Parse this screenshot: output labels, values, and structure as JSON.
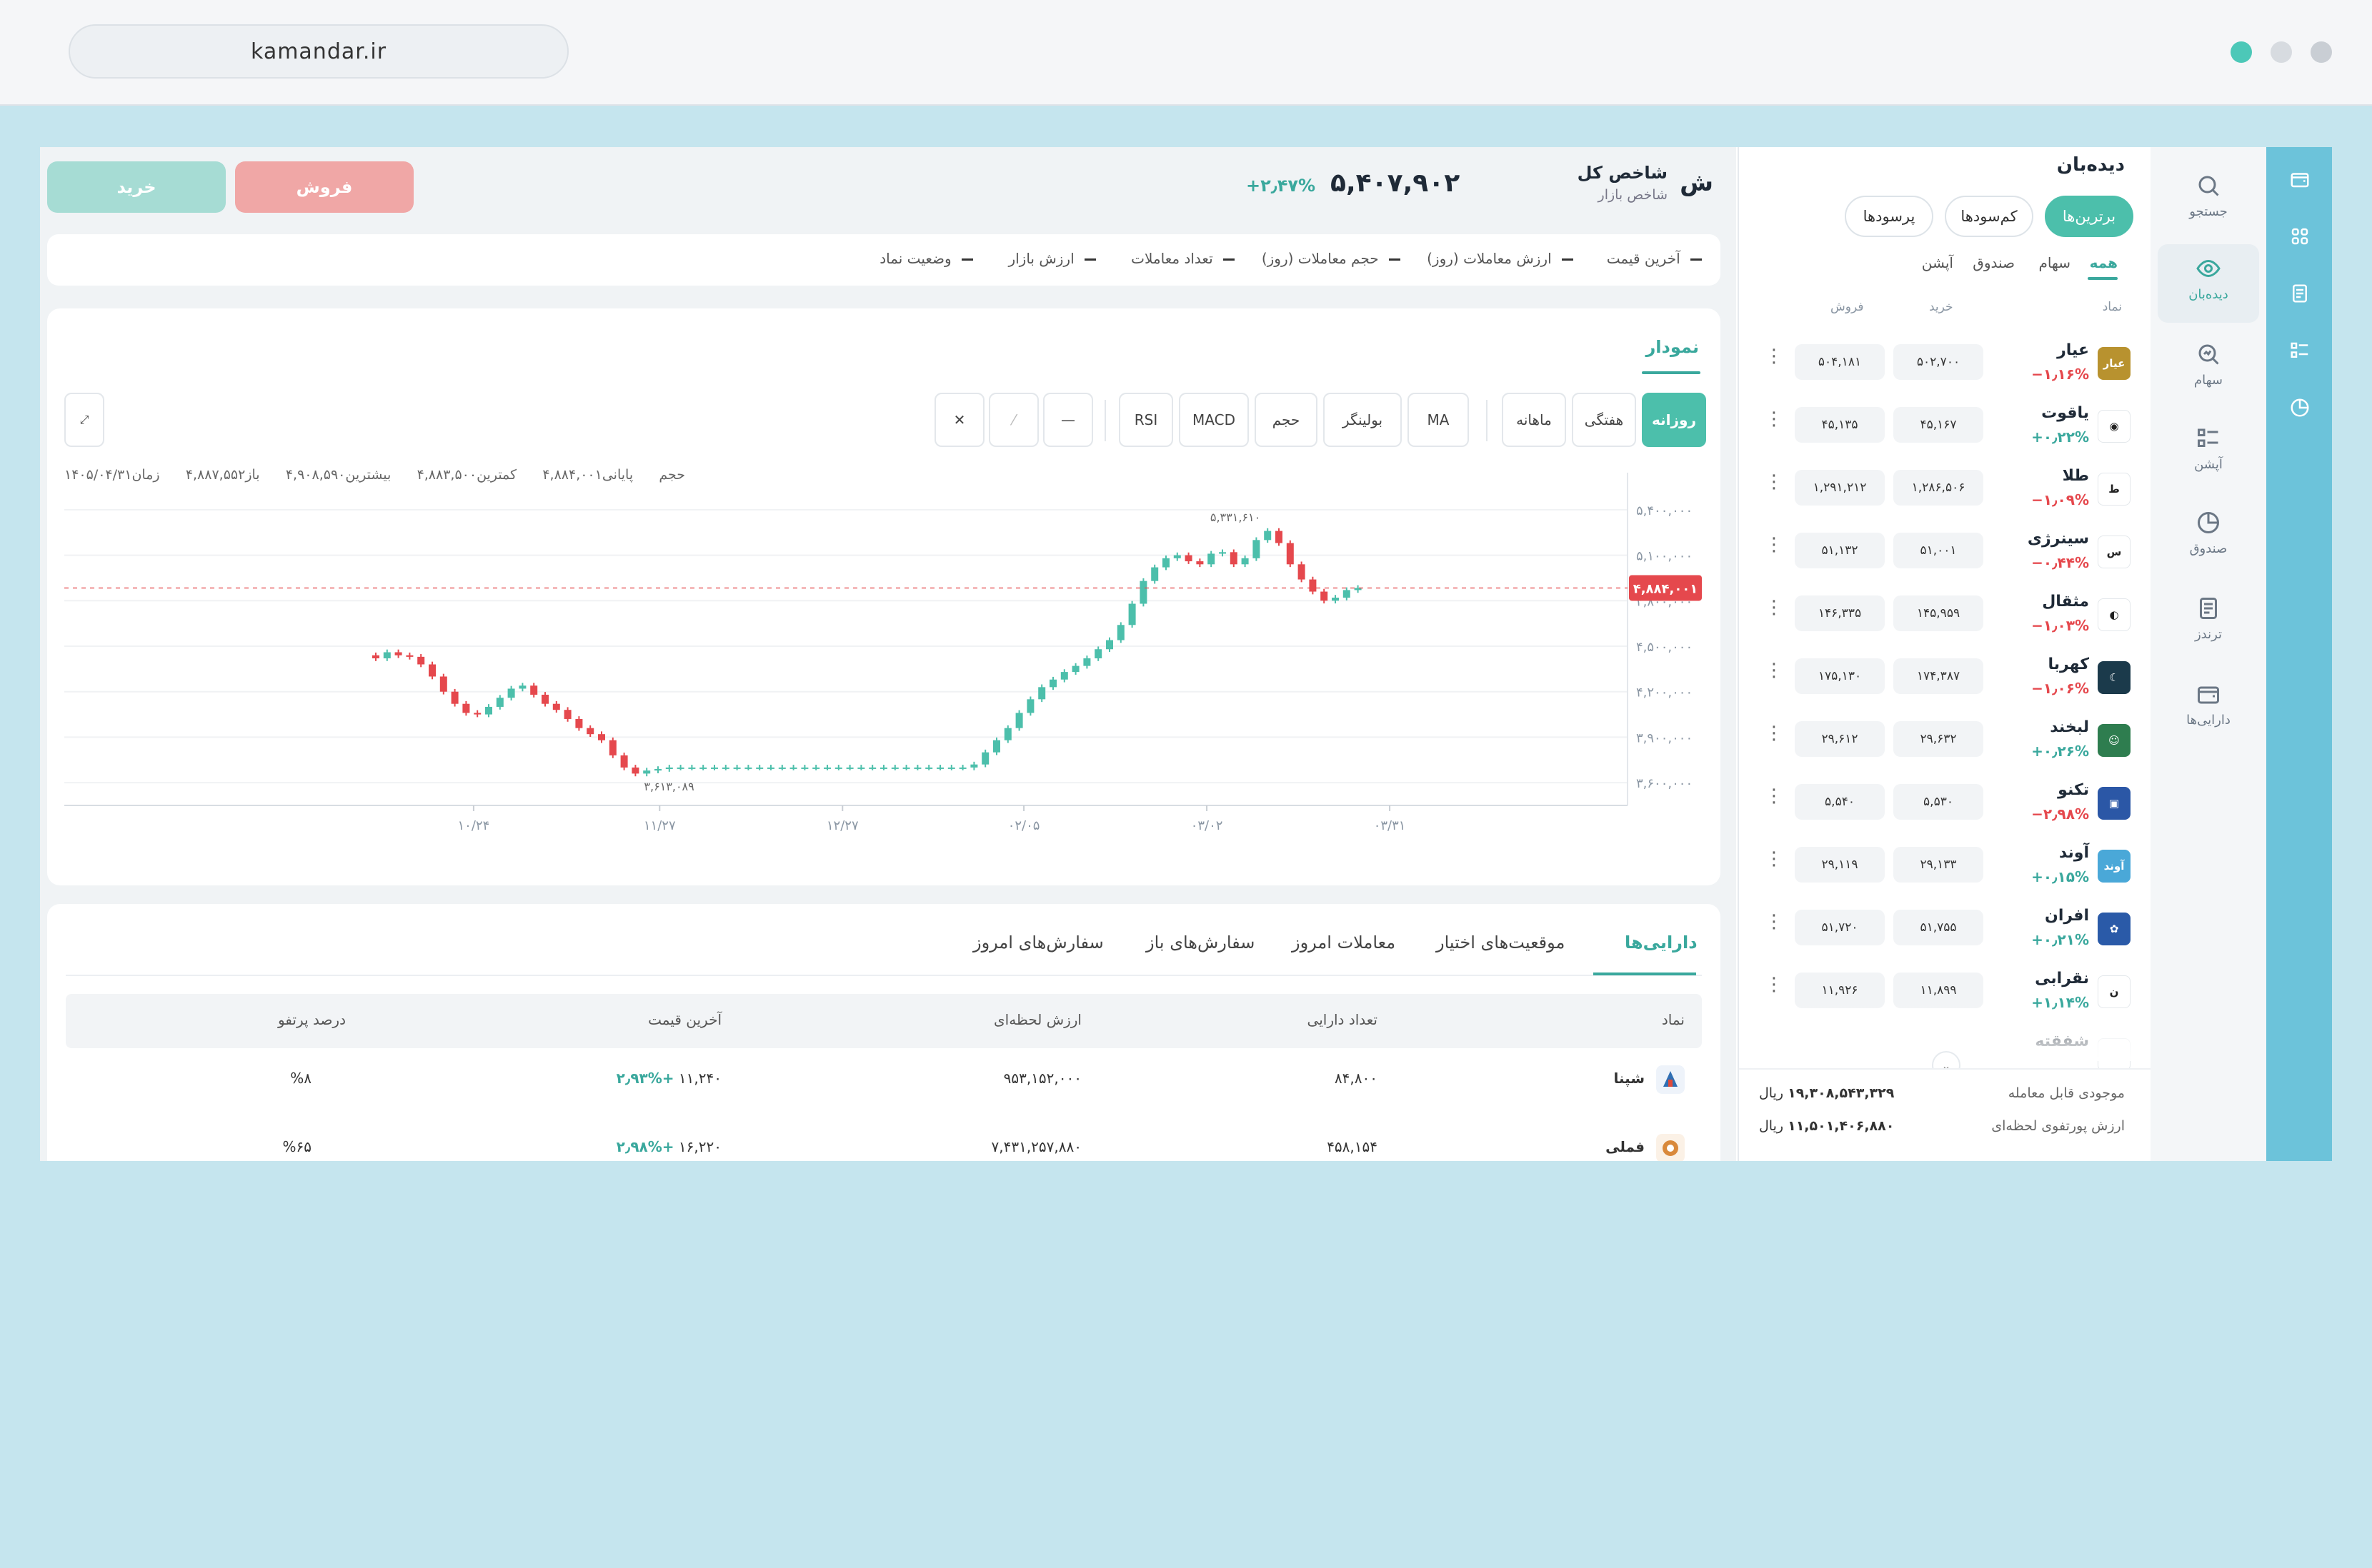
{
  "browser": {
    "url": "kamandar.ir"
  },
  "colors": {
    "accent": "#4cbfab",
    "positive": "#3aa89d",
    "negative": "#e5484d",
    "rail": "#6cc3da",
    "sell": "#f0a7a6",
    "buy": "#a6dcd4"
  },
  "sidenav": {
    "items": [
      {
        "label": "جستجو",
        "icon": "search-icon"
      },
      {
        "label": "دیده‌بان",
        "icon": "eye-icon",
        "active": true
      },
      {
        "label": "سهام",
        "icon": "stock-search-icon"
      },
      {
        "label": "آپشن",
        "icon": "checklist-icon"
      },
      {
        "label": "صندوق",
        "icon": "pie-icon"
      },
      {
        "label": "ترندز",
        "icon": "document-icon"
      },
      {
        "label": "دارایی‌ها",
        "icon": "wallet-icon"
      }
    ]
  },
  "watchlist": {
    "title": "دیده‌بان",
    "pills": [
      "برترین‌ها",
      "کم‌سودها",
      "پرسودها"
    ],
    "subtabs": [
      "همه",
      "سهام",
      "صندوق",
      "آپشن"
    ],
    "columns": {
      "symbol": "نماد",
      "buy": "خرید",
      "sell": "فروش"
    },
    "items": [
      {
        "name": "عیار",
        "change": "−۱٫۱۶%",
        "dir": "neg",
        "buy": "۵۰۲,۷۰۰",
        "sell": "۵۰۴,۱۸۱",
        "logo_text": "عیار",
        "logo_color": "#b8922f"
      },
      {
        "name": "یاقوت",
        "change": "+۰٫۲۲%",
        "dir": "pos",
        "buy": "۴۵,۱۶۷",
        "sell": "۴۵,۱۳۵",
        "logo_text": "◉",
        "logo_color": "#ffffff"
      },
      {
        "name": "طلا",
        "change": "−۱٫۰۹%",
        "dir": "neg",
        "buy": "۱,۲۸۶,۵۰۶",
        "sell": "۱,۲۹۱,۲۱۲",
        "logo_text": "ط",
        "logo_color": "#ffffff"
      },
      {
        "name": "سینرژی",
        "change": "−۰٫۴۴%",
        "dir": "neg",
        "buy": "۵۱,۰۰۱",
        "sell": "۵۱,۱۳۲",
        "logo_text": "س",
        "logo_color": "#ffffff"
      },
      {
        "name": "مثقال",
        "change": "−۱٫۰۳%",
        "dir": "neg",
        "buy": "۱۴۵,۹۵۹",
        "sell": "۱۴۶,۳۳۵",
        "logo_text": "◐",
        "logo_color": "#ffffff"
      },
      {
        "name": "کهربا",
        "change": "−۱٫۰۶%",
        "dir": "neg",
        "buy": "۱۷۴,۳۸۷",
        "sell": "۱۷۵,۱۳۰",
        "logo_text": "☾",
        "logo_color": "#1b3a4b"
      },
      {
        "name": "لبخند",
        "change": "+۰٫۲۶%",
        "dir": "pos",
        "buy": "۲۹,۶۳۲",
        "sell": "۲۹,۶۱۲",
        "logo_text": "☺",
        "logo_color": "#2e7d4f"
      },
      {
        "name": "تکنو",
        "change": "−۲٫۹۸%",
        "dir": "neg",
        "buy": "۵,۵۳۰",
        "sell": "۵,۵۴۰",
        "logo_text": "▣",
        "logo_color": "#2b57a6"
      },
      {
        "name": "آوند",
        "change": "+۰٫۱۵%",
        "dir": "pos",
        "buy": "۲۹,۱۳۳",
        "sell": "۲۹,۱۱۹",
        "logo_text": "آوند",
        "logo_color": "#4aa8d8"
      },
      {
        "name": "افران",
        "change": "+۰٫۲۱%",
        "dir": "pos",
        "buy": "۵۱,۷۵۵",
        "sell": "۵۱,۷۲۰",
        "logo_text": "✿",
        "logo_color": "#2a5aa8"
      },
      {
        "name": "نقرابی",
        "change": "+۱٫۱۴%",
        "dir": "pos",
        "buy": "۱۱,۸۹۹",
        "sell": "۱۱,۹۲۶",
        "logo_text": "ن",
        "logo_color": "#ffffff"
      },
      {
        "name": "شفقته",
        "change": "",
        "dir": "pos",
        "buy": "",
        "sell": "",
        "logo_text": "",
        "logo_color": "#ffffff"
      }
    ],
    "footer": {
      "balance_label": "موجودی قابل معامله",
      "balance_value": "۱۹,۳۰۸,۵۴۳,۳۲۹",
      "portfolio_label": "ارزش پورتفوی لحظه‌ای",
      "portfolio_value": "۱۱,۵۰۱,۴۰۶,۸۸۰",
      "currency": "ریال"
    }
  },
  "header": {
    "symbol": "ش",
    "name": "شاخص کل",
    "subtitle": "شاخص بازار",
    "price": "۵,۴۰۷,۹۰۲",
    "change": "+۲٫۴۷%",
    "sell_label": "فروش",
    "buy_label": "خرید"
  },
  "stats": [
    "آخرین قیمت",
    "ارزش معاملات (روز)",
    "حجم معاملات (روز)",
    "تعداد معاملات",
    "ارزش بازار",
    "وضعیت نماد"
  ],
  "chart": {
    "tab": "نمودار",
    "timeframes": [
      "روزانه",
      "هفتگی",
      "ماهانه"
    ],
    "indicators": [
      "MA",
      "بولینگر",
      "حجم",
      "MACD",
      "RSI"
    ],
    "tools": {
      "line": "—",
      "ray": "⁄",
      "clear": "✕",
      "expand": "⤢"
    },
    "ohlc": {
      "volume_label": "حجم",
      "close_label": "پایانی",
      "close": "۴,۸۸۴,۰۰۱",
      "low_label": "کمترین",
      "low": "۴,۸۸۳,۵۰۰",
      "high_label": "بیشترین",
      "high": "۴,۹۰۸,۵۹۰",
      "open_label": "باز",
      "open": "۴,۸۸۷,۵۵۲",
      "time_label": "زمان",
      "time": "۱۴۰۵/۰۴/۳۱"
    },
    "max_label": "۵,۳۳۱,۶۱۰",
    "min_label": "۳,۶۱۳,۰۸۹",
    "last_price_label": "۴,۸۸۴,۰۰۱"
  },
  "chart_data": {
    "type": "line",
    "subtype": "candlestick",
    "title": "",
    "xlabel": "",
    "ylabel": "",
    "ylim": [
      3450000,
      5550000
    ],
    "y_ticks": [
      3600000,
      3900000,
      4200000,
      4500000,
      4800000,
      5100000,
      5400000
    ],
    "y_tick_labels": [
      "۳,۶۰۰,۰۰۰",
      "۳,۹۰۰,۰۰۰",
      "۴,۲۰۰,۰۰۰",
      "۴,۵۰۰,۰۰۰",
      "۴,۸۰۰,۰۰۰",
      "۵,۱۰۰,۰۰۰",
      "۵,۴۰۰,۰۰۰"
    ],
    "x_tick_labels": [
      "۱۰/۲۴",
      "۱۱/۲۷",
      "۱۲/۲۷",
      "۰۲/۰۵",
      "۰۳/۰۲",
      "۰۳/۳۱"
    ],
    "last_price": 4884001,
    "series": [
      {
        "values": [
          4420000,
          4460000,
          4440000,
          4430000,
          4380000,
          4300000,
          4200000,
          4120000,
          4060000,
          4050000,
          4100000,
          4160000,
          4220000,
          4240000,
          4180000,
          4120000,
          4080000,
          4020000,
          3960000,
          3920000,
          3880000,
          3780000,
          3700000,
          3660000,
          3680000,
          3690000,
          3700000,
          3700000,
          3700000,
          3700000,
          3700000,
          3700000,
          3700000,
          3700000,
          3700000,
          3700000,
          3700000,
          3700000,
          3700000,
          3700000,
          3700000,
          3700000,
          3700000,
          3700000,
          3700000,
          3700000,
          3700000,
          3700000,
          3700000,
          3700000,
          3700000,
          3700000,
          3700000,
          3720000,
          3800000,
          3880000,
          3960000,
          4060000,
          4150000,
          4230000,
          4280000,
          4330000,
          4370000,
          4420000,
          4480000,
          4540000,
          4640000,
          4780000,
          4930000,
          5020000,
          5080000,
          5100000,
          5060000,
          5040000,
          5110000,
          5120000,
          5040000,
          5080000,
          5200000,
          5260000,
          5180000,
          5040000,
          4940000,
          4860000,
          4800000,
          4820000,
          4870000,
          4884001
        ]
      }
    ]
  },
  "positions": {
    "tabs": [
      "دارایی‌ها",
      "موقعیت‌های اختیار",
      "معاملات امروز",
      "سفارش‌های باز",
      "سفارش‌های امروز"
    ],
    "columns": [
      "نماد",
      "تعداد دارایی",
      "ارزش لحظه‌ای",
      "آخرین قیمت",
      "درصد پرتفو"
    ],
    "rows": [
      {
        "symbol": "شپنا",
        "qty": "۸۴,۸۰۰",
        "value": "۹۵۳,۱۵۲,۰۰۰",
        "price": "۱۱,۲۴۰",
        "price_change": "+۲٫۹۳%",
        "pct": "%۸",
        "logo_color": "#2f6fb3"
      },
      {
        "symbol": "فملی",
        "qty": "۴۵۸,۱۵۴",
        "value": "۷,۴۳۱,۲۵۷,۸۸۰",
        "price": "۱۶,۲۲۰",
        "price_change": "+۲٫۹۸%",
        "pct": "%۶۵",
        "logo_color": "#d9893b"
      }
    ]
  }
}
